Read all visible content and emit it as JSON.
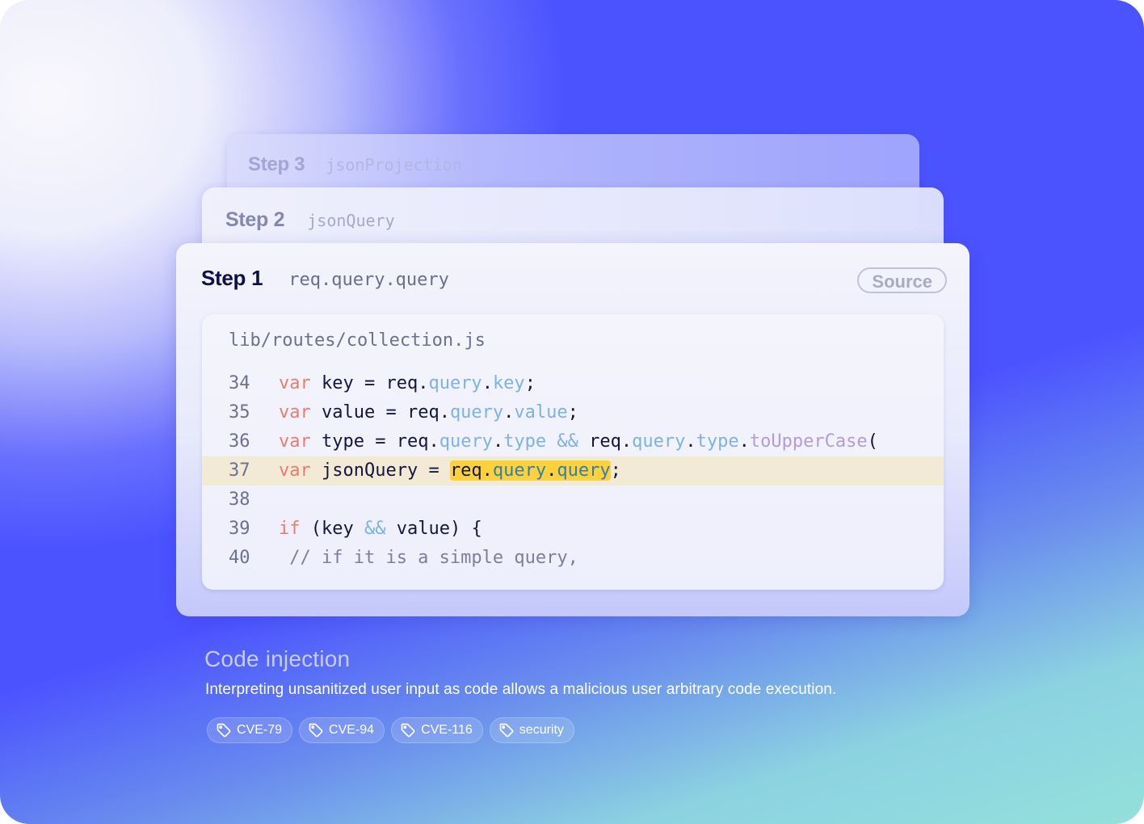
{
  "steps": [
    {
      "label": "Step 3",
      "variable": "jsonProjection"
    },
    {
      "label": "Step 2",
      "variable": "jsonQuery"
    },
    {
      "label": "Step 1",
      "variable": "req.query.query",
      "action_label": "Source"
    }
  ],
  "code": {
    "file_path": "lib/routes/collection.js",
    "highlighted_line": 37,
    "lines": [
      {
        "number": "34",
        "tokens": [
          [
            "kw",
            "var"
          ],
          [
            "t",
            " key = req."
          ],
          [
            "prop",
            "query"
          ],
          [
            "t",
            "."
          ],
          [
            "prop",
            "key"
          ],
          [
            "t",
            ";"
          ]
        ]
      },
      {
        "number": "35",
        "tokens": [
          [
            "kw",
            "var"
          ],
          [
            "t",
            " value = req."
          ],
          [
            "prop",
            "query"
          ],
          [
            "t",
            "."
          ],
          [
            "prop",
            "value"
          ],
          [
            "t",
            ";"
          ]
        ]
      },
      {
        "number": "36",
        "tokens": [
          [
            "kw",
            "var"
          ],
          [
            "t",
            " type = req."
          ],
          [
            "prop",
            "query"
          ],
          [
            "t",
            "."
          ],
          [
            "prop",
            "type"
          ],
          [
            "t",
            " "
          ],
          [
            "op",
            "&&"
          ],
          [
            "t",
            " req."
          ],
          [
            "prop",
            "query"
          ],
          [
            "t",
            "."
          ],
          [
            "prop",
            "type"
          ],
          [
            "t",
            "."
          ],
          [
            "fn",
            "toUpperCase"
          ],
          [
            "t",
            "("
          ]
        ]
      },
      {
        "number": "37",
        "tokens": [
          [
            "kw",
            "var"
          ],
          [
            "t",
            " jsonQuery = "
          ],
          [
            "mark",
            "req.|query|.|query"
          ],
          [
            "t",
            ";"
          ]
        ]
      },
      {
        "number": "38",
        "tokens": []
      },
      {
        "number": "39",
        "tokens": [
          [
            "kw",
            "if"
          ],
          [
            "t",
            " (key "
          ],
          [
            "op",
            "&&"
          ],
          [
            "t",
            " value) {"
          ]
        ]
      },
      {
        "number": "40",
        "tokens": [
          [
            "cm",
            " // if it is a simple query,"
          ]
        ]
      }
    ]
  },
  "finding": {
    "title": "Code injection",
    "description": "Interpreting unsanitized user input as code allows a malicious user arbitrary code execution.",
    "tags": [
      {
        "label": "CVE-79",
        "icon": "tag-icon"
      },
      {
        "label": "CVE-94",
        "icon": "tag-icon"
      },
      {
        "label": "CVE-116",
        "icon": "tag-icon"
      },
      {
        "label": "security",
        "icon": "tag-icon"
      }
    ]
  },
  "colors": {
    "background_primary": "#4b53ff",
    "background_accent": "#94e0dc",
    "keyword": "#ee7a6e",
    "property": "#7cb2ea",
    "function": "#b69ae0",
    "highlight_line": "#f3ead6",
    "highlight_mark": "#fdd13c"
  }
}
